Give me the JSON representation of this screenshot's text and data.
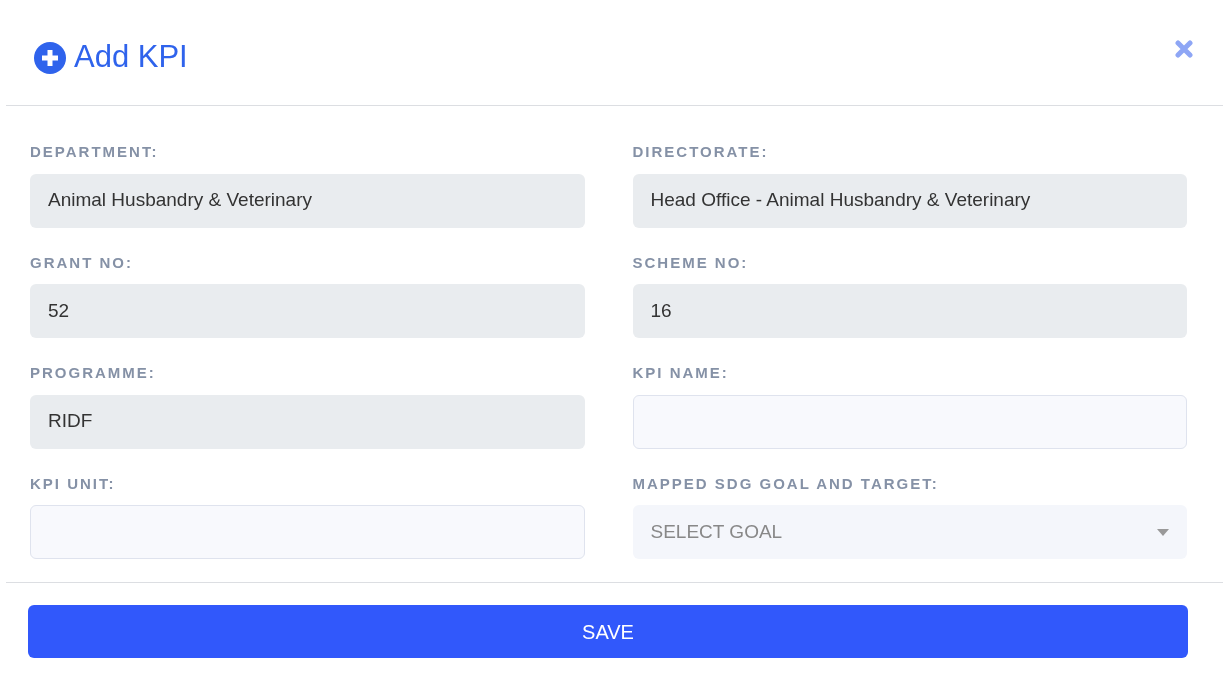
{
  "dialog": {
    "title": "Add KPI"
  },
  "fields": [
    {
      "label": "DEPARTMENT:",
      "kind": "readonly",
      "value": "Animal Husbandry & Veterinary"
    },
    {
      "label": "DIRECTORATE:",
      "kind": "readonly",
      "value": "Head Office - Animal Husbandry & Veterinary"
    },
    {
      "label": "GRANT NO:",
      "kind": "readonly",
      "value": "52"
    },
    {
      "label": "SCHEME NO:",
      "kind": "readonly",
      "value": "16"
    },
    {
      "label": "PROGRAMME:",
      "kind": "readonly",
      "value": "RIDF"
    },
    {
      "label": "KPI NAME:",
      "kind": "input"
    },
    {
      "label": "KPI UNIT:",
      "kind": "input"
    },
    {
      "label": "MAPPED SDG GOAL AND TARGET:",
      "kind": "select",
      "placeholder": "SELECT GOAL"
    }
  ],
  "save_button": "SAVE"
}
